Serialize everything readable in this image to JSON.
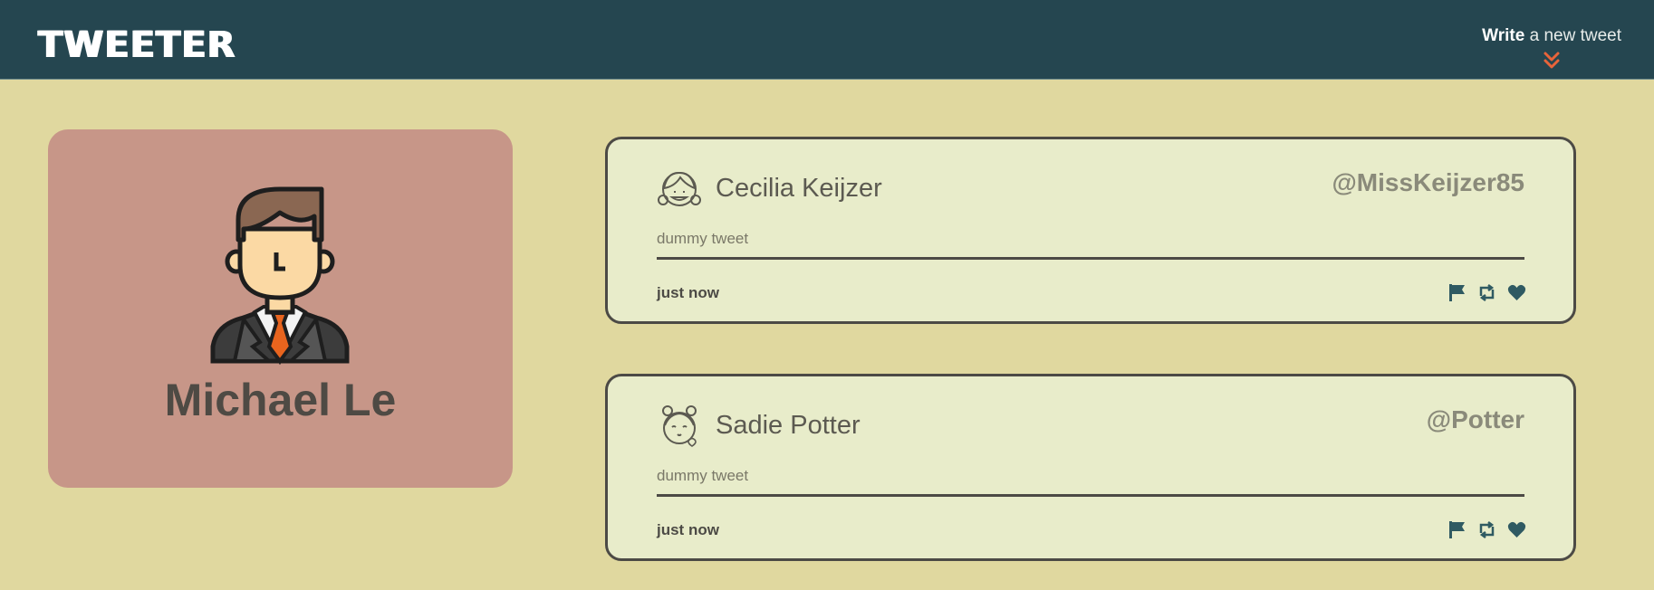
{
  "nav": {
    "brand": "TWEETER",
    "compose_bold": "Write",
    "compose_rest": " a new tweet",
    "accent_color": "#e8643a"
  },
  "profile": {
    "name": "Michael Le",
    "avatar_icon": "businessman-avatar-icon"
  },
  "tweets": [
    {
      "name": "Cecilia Keijzer",
      "handle": "@MissKeijzer85",
      "content": "dummy tweet",
      "time": "just now",
      "avatar_icon": "girl-braids-avatar-icon"
    },
    {
      "name": "Sadie Potter",
      "handle": "@Potter",
      "content": "dummy tweet",
      "time": "just now",
      "avatar_icon": "girl-buns-avatar-icon"
    }
  ],
  "actions": [
    "flag-icon",
    "retweet-icon",
    "heart-icon"
  ],
  "colors": {
    "nav_bg": "#254650",
    "page_bg": "#e0d89f",
    "profile_bg": "#c79688",
    "tweet_bg": "#e8ecca",
    "icon_color": "#2f5a62"
  }
}
